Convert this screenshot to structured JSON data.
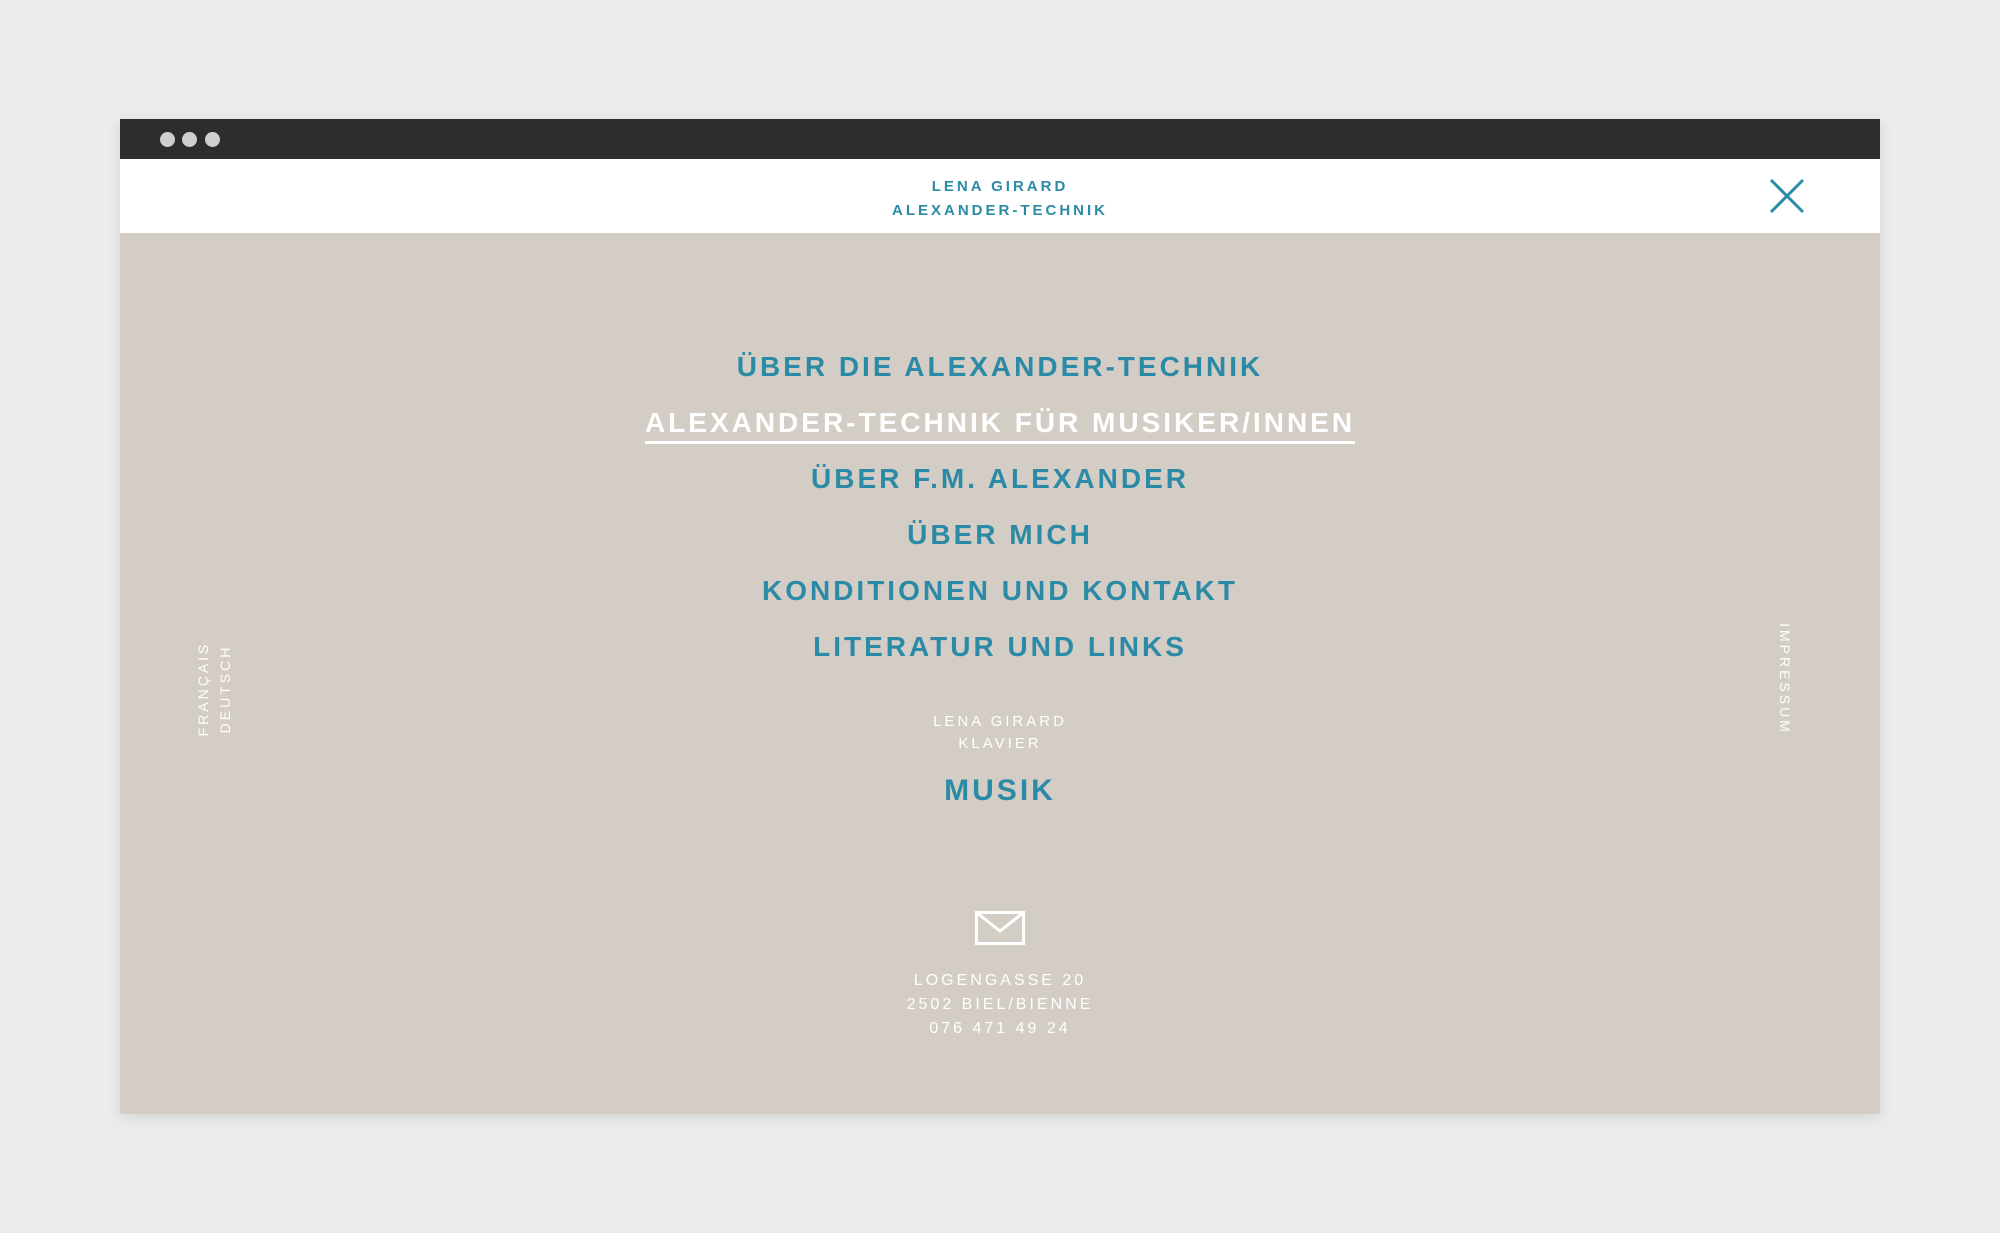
{
  "header": {
    "brand_line1": "LENA GIRARD",
    "brand_line2": "ALEXANDER-TECHNIK"
  },
  "menu": {
    "items": [
      {
        "label": "ÜBER DIE ALEXANDER-TECHNIK"
      },
      {
        "label": "ALEXANDER-TECHNIK FÜR MUSIKER/INNEN"
      },
      {
        "label": "ÜBER F.M. ALEXANDER"
      },
      {
        "label": "ÜBER MICH"
      },
      {
        "label": "KONDITIONEN UND KONTAKT"
      },
      {
        "label": "LITERATUR UND LINKS"
      }
    ]
  },
  "secondary": {
    "line1": "LENA GIRARD",
    "line2": "KLAVIER",
    "link": "MUSIK"
  },
  "contact": {
    "address_line1": "LOGENGASSE 20",
    "address_line2": "2502 BIEL/BIENNE",
    "phone": "076 471 49 24"
  },
  "language": {
    "french": "FRANÇAIS",
    "german": "DEUTSCH"
  },
  "footer": {
    "impressum": "IMPRESSUM"
  },
  "colors": {
    "accent": "#2b8aa6",
    "background": "#d3cdc5",
    "chrome": "#2e2d2b",
    "active_text": "#ffffff"
  },
  "icons": {
    "close": "close-icon",
    "mail": "mail-icon"
  }
}
